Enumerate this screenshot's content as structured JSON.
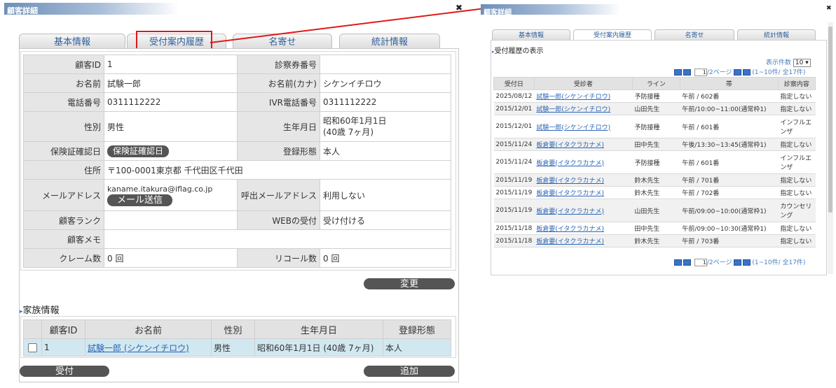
{
  "left": {
    "window_title": "顧客詳細",
    "close": "✖",
    "tabs": [
      "基本情報",
      "受付案内履歴",
      "名寄せ",
      "統計情報"
    ],
    "fields": {
      "customer_id_label": "顧客ID",
      "customer_id": "1",
      "ticket_no_label": "診察券番号",
      "ticket_no": "",
      "name_label": "お名前",
      "name": "試験一郎",
      "kana_label": "お名前(カナ)",
      "kana": "シケンイチロウ",
      "phone_label": "電話番号",
      "phone": "0311112222",
      "ivr_label": "IVR電話番号",
      "ivr": "0311112222",
      "gender_label": "性別",
      "gender": "男性",
      "birth_label": "生年月日",
      "birth_line1": "昭和60年1月1日",
      "birth_line2": "(40歳 7ヶ月)",
      "ins_label": "保険証確認日",
      "ins_button": "保険証確認日",
      "reg_label": "登録形態",
      "reg": "本人",
      "address_label": "住所",
      "address": "〒100-0001東京都 千代田区千代田",
      "email_label": "メールアドレス",
      "email": "kaname.itakura@iflag.co.jp",
      "email_button": "メール送信",
      "call_email_label": "呼出メールアドレス",
      "call_email": "利用しない",
      "rank_label": "顧客ランク",
      "rank": "",
      "web_label": "WEBの受付",
      "web": "受け付ける",
      "memo_label": "顧客メモ",
      "memo": "",
      "claim_label": "クレーム数",
      "claim": "0 回",
      "recall_label": "リコール数",
      "recall": "0 回"
    },
    "change_button": "変更",
    "family_title": "家族情報",
    "family_headers": [
      "顧客ID",
      "お名前",
      "性別",
      "生年月日",
      "登録形態"
    ],
    "family_row": {
      "id": "1",
      "name": "試験一郎 (シケンイチロウ)",
      "gender": "男性",
      "birth": "昭和60年1月1日 (40歳 7ヶ月)",
      "reg": "本人"
    },
    "receive_button": "受付",
    "add_button": "追加"
  },
  "right": {
    "window_title": "顧客詳細",
    "close": "✖",
    "tabs": [
      "基本情報",
      "受付案内履歴",
      "名寄せ",
      "統計情報"
    ],
    "section_title": "受付履歴の表示",
    "per_page_label": "表示件数",
    "per_page_value": "10",
    "page_value": "1",
    "page_suffix": "/2ページ",
    "range": "(1~10件/ 全17件)",
    "headers": [
      "受付日",
      "受診者",
      "ライン",
      "帯",
      "診察内容"
    ],
    "rows": [
      {
        "date": "2025/08/12",
        "patient": "試験一郎(シケンイチロウ)",
        "line": "予防接種",
        "band": "午前 / 602番",
        "content": "指定しない"
      },
      {
        "date": "2015/12/01",
        "patient": "試験一郎(シケンイチロウ)",
        "line": "山田先生",
        "band": "午前/10:00~11:00(通常枠1)",
        "content": "指定しない"
      },
      {
        "date": "2015/12/01",
        "patient": "試験一郎(シケンイチロウ)",
        "line": "予防接種",
        "band": "午前 / 601番",
        "content": "インフルエンザ"
      },
      {
        "date": "2015/11/24",
        "patient": "板倉要(イタクラカナメ)",
        "line": "田中先生",
        "band": "午後/13:30~13:45(通常枠1)",
        "content": "指定しない"
      },
      {
        "date": "2015/11/24",
        "patient": "板倉要(イタクラカナメ)",
        "line": "予防接種",
        "band": "午前 / 601番",
        "content": "インフルエンザ"
      },
      {
        "date": "2015/11/19",
        "patient": "板倉要(イタクラカナメ)",
        "line": "鈴木先生",
        "band": "午前 / 701番",
        "content": "指定しない"
      },
      {
        "date": "2015/11/19",
        "patient": "板倉要(イタクラカナメ)",
        "line": "鈴木先生",
        "band": "午前 / 702番",
        "content": "指定しない"
      },
      {
        "date": "2015/11/19",
        "patient": "板倉要(イタクラカナメ)",
        "line": "山田先生",
        "band": "午前/09:00~10:00(通常枠1)",
        "content": "カウンセリング"
      },
      {
        "date": "2015/11/18",
        "patient": "板倉要(イタクラカナメ)",
        "line": "田中先生",
        "band": "午前/09:00~10:30(通常枠1)",
        "content": "指定しない"
      },
      {
        "date": "2015/11/18",
        "patient": "板倉要(イタクラカナメ)",
        "line": "鈴木先生",
        "band": "午前 / 703番",
        "content": "指定しない"
      }
    ]
  }
}
